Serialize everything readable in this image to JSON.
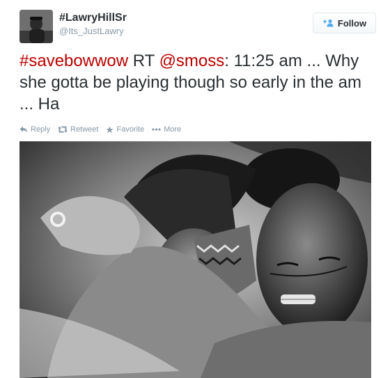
{
  "user": {
    "display_name": "#LawryHillSr",
    "handle": "@Its_JustLawry"
  },
  "follow_button": {
    "label": "Follow",
    "icon": "add-user-icon"
  },
  "tweet": {
    "hashtag": "#savebowwow",
    "text_rt": " RT ",
    "mention": "@smoss",
    "text_rest": ": 11:25 am ... Why she gotta be playing though so early in the am ... Ha",
    "link_color": "#bb0000"
  },
  "actions": [
    {
      "label": "Reply",
      "icon": "reply-icon"
    },
    {
      "label": "Retweet",
      "icon": "retweet-icon"
    },
    {
      "label": "Favorite",
      "icon": "star-icon"
    },
    {
      "label": "More",
      "icon": "more-dots-icon"
    }
  ],
  "photo": {
    "style": "black-and-white"
  }
}
